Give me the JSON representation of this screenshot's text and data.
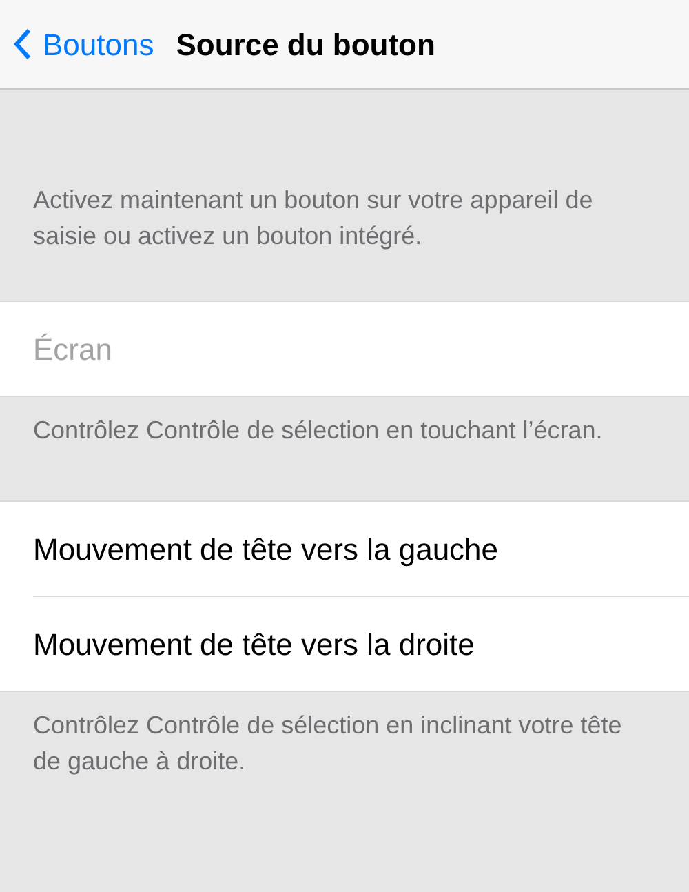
{
  "nav": {
    "back": "Boutons",
    "title": "Source du bouton"
  },
  "intro": "Activez maintenant un bouton sur votre appareil de saisie ou activez un bouton intégré.",
  "groups": [
    {
      "rows": [
        {
          "label": "Écran",
          "disabled": true
        }
      ],
      "footer": "Contrôlez Contrôle de sélection en touchant l’écran."
    },
    {
      "rows": [
        {
          "label": "Mouvement de tête vers la gauche",
          "disabled": false
        },
        {
          "label": "Mouvement de tête vers la droite",
          "disabled": false
        }
      ],
      "footer": "Contrôlez Contrôle de sélection en inclinant votre tête de gauche à droite."
    }
  ]
}
